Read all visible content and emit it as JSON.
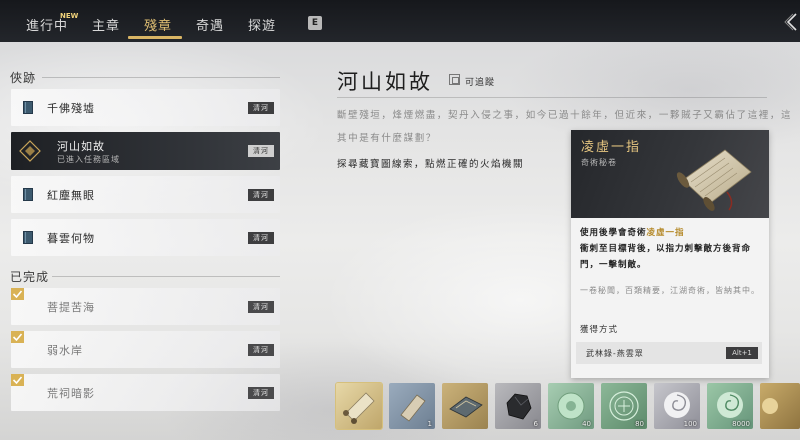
{
  "tabs": [
    {
      "label": "進行中",
      "badge": "NEW"
    },
    {
      "label": "主章"
    },
    {
      "label": "殘章",
      "active": true
    },
    {
      "label": "奇遇"
    },
    {
      "label": "探遊"
    }
  ],
  "key_hint": "E",
  "sections": {
    "active_header": "俠跡",
    "completed_header": "已完成"
  },
  "quests": [
    {
      "name": "千佛殘墟",
      "tag": "清河"
    },
    {
      "name": "河山如故",
      "sub": "已進入任務區域",
      "tag": "清河",
      "selected": true
    },
    {
      "name": "紅塵無眼",
      "tag": "清河"
    },
    {
      "name": "暮雲何物",
      "tag": "清河"
    }
  ],
  "completed": [
    {
      "name": "菩提苦海",
      "tag": "清河"
    },
    {
      "name": "弱水岸",
      "tag": "清河"
    },
    {
      "name": "荒祠暗影",
      "tag": "清河"
    }
  ],
  "detail": {
    "title": "河山如故",
    "trackable": "可追蹤",
    "description": "斷壁殘垣，烽煙燃盡，契丹入侵之事，如今已過十餘年，但近來，一夥賊子又霸佔了這裡，這其中是有什麼謀劃？",
    "objective": "探尋藏寶圖線索，點燃正確的火焰機關"
  },
  "reward_tooltip": {
    "name": "凌虛一指",
    "type": "奇術秘卷",
    "body_prefix": "使用後學會奇術",
    "body_highlight": "凌虛一指",
    "body_rest": "衝刺至目標背後，以指力刺擊敵方後背命門，一擊制敵。",
    "flavor": "一卷秘聞，百類精要，江湖奇術，皆納其中。",
    "obtain_label": "獲得方式",
    "source": "武林錄-燕雲眾",
    "source_key": "Alt+1"
  },
  "reward_slots": [
    {
      "icon": "scroll-icon",
      "qty": "",
      "color": "#c9b27a"
    },
    {
      "icon": "paper-icon",
      "qty": "1",
      "color": "#8a9bb0"
    },
    {
      "icon": "map-icon",
      "qty": "",
      "color": "#b89b5a"
    },
    {
      "icon": "ore-icon",
      "qty": "6",
      "color": "#9c9c9c"
    },
    {
      "icon": "jade-ring-icon",
      "qty": "40",
      "color": "#8ab89a"
    },
    {
      "icon": "seal-icon",
      "qty": "80",
      "color": "#7fa88a"
    },
    {
      "icon": "cloud-swirl-icon",
      "qty": "100",
      "color": "#b5b5bb"
    },
    {
      "icon": "jade-swirl-icon",
      "qty": "8000",
      "color": "#7fb090"
    },
    {
      "icon": "partial-item-icon",
      "qty": "",
      "color": "#c0a060"
    }
  ]
}
